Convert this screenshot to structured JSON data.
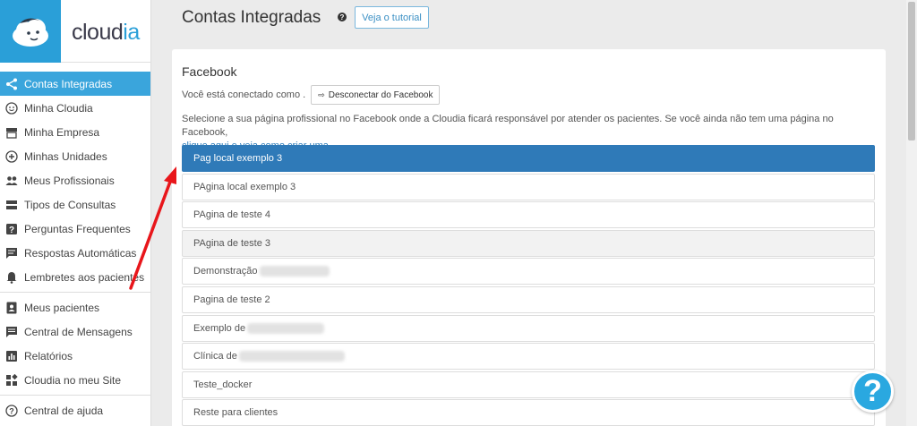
{
  "brand": {
    "name_part1": "cloud",
    "name_part2": "ia",
    "accent": "#2a9fd8"
  },
  "sidebar": {
    "items": [
      {
        "label": "Contas Integradas",
        "icon": "share-icon",
        "active": true
      },
      {
        "label": "Minha Cloudia",
        "icon": "face-icon"
      },
      {
        "label": "Minha Empresa",
        "icon": "store-icon"
      },
      {
        "label": "Minhas Unidades",
        "icon": "plus-circle-icon"
      },
      {
        "label": "Meus Profissionais",
        "icon": "people-icon"
      },
      {
        "label": "Tipos de Consultas",
        "icon": "list-icon"
      },
      {
        "label": "Perguntas Frequentes",
        "icon": "question-box-icon"
      },
      {
        "label": "Respostas Automáticas",
        "icon": "chat-icon"
      },
      {
        "label": "Lembretes aos pacientes",
        "icon": "bell-icon"
      },
      {
        "label": "Meus pacientes",
        "icon": "contact-icon"
      },
      {
        "label": "Central de Mensagens",
        "icon": "message-icon"
      },
      {
        "label": "Relatórios",
        "icon": "chart-icon"
      },
      {
        "label": "Cloudia no meu Site",
        "icon": "widgets-icon"
      },
      {
        "label": "Central de ajuda",
        "icon": "help-circle-icon"
      }
    ]
  },
  "header": {
    "title": "Contas Integradas",
    "tutorial_label": "Veja o tutorial"
  },
  "facebook": {
    "title": "Facebook",
    "connected_text": "Você está conectado como .",
    "disconnect_label": "Desconectar do Facebook",
    "description": "Selecione a sua página profissional no Facebook onde a Cloudia ficará responsável por atender os pacientes. Se você ainda não tem uma página no Facebook,",
    "link_text": "clique aqui e veja como criar uma.",
    "pages": [
      "Pag local exemplo 3",
      "PAgina local exemplo 3",
      "PAgina de teste 4",
      "PAgina de teste 3",
      "Demonstração",
      "Pagina de teste 2",
      "Exemplo de",
      "Clínica de",
      "Teste_docker",
      "Reste para clientes"
    ],
    "selected_index": 0
  },
  "help_fab_label": "?"
}
